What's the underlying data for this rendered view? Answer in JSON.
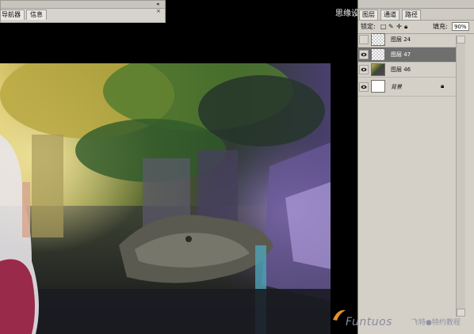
{
  "nav_panel": {
    "tabs": [
      "导航器",
      "信息"
    ],
    "controls": "◂ ×"
  },
  "canvas": {
    "description_icon": "painting-image"
  },
  "layers_panel": {
    "tabs": [
      "图层",
      "通道",
      "路径"
    ],
    "lock_label": "锁定:",
    "fill_label": "填充:",
    "fill_value": "90%",
    "layers": [
      {
        "name": "图层 24",
        "visible": false,
        "thumb": "transparent",
        "selected": false
      },
      {
        "name": "图层 47",
        "visible": true,
        "thumb": "transparent",
        "selected": true
      },
      {
        "name": "图层 46",
        "visible": true,
        "thumb": "painting",
        "selected": false
      },
      {
        "name": "背景",
        "visible": true,
        "thumb": "white",
        "selected": false,
        "locked": true
      }
    ]
  },
  "watermarks": {
    "top": "思缘设计论坛 WWW.MISSYUAN.COM",
    "bottom_brand": "Funtuos",
    "bottom_sub": "飞特●特约教程"
  },
  "colors": {
    "panel_bg": "#d4d0c8",
    "selected_row": "#6f6f6f"
  }
}
